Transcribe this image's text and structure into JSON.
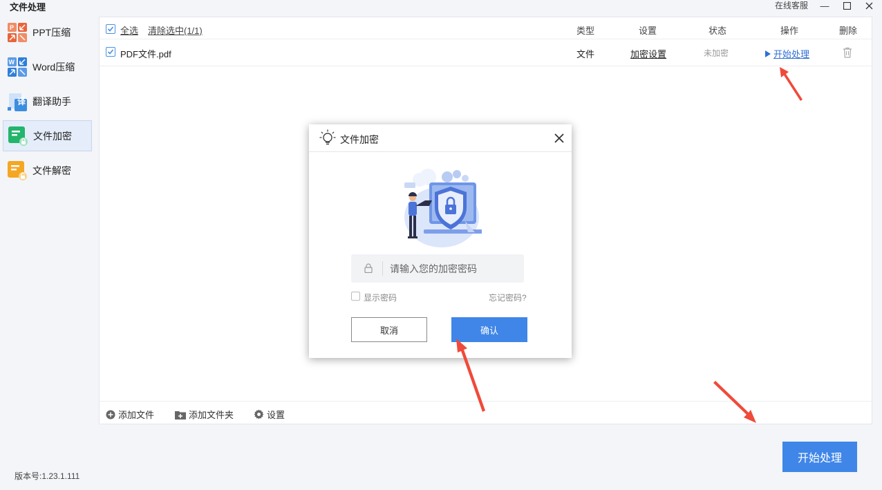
{
  "window": {
    "title": "文件处理",
    "online_service": "在线客服",
    "minimize_glyph": "—",
    "maximize_glyph": "☐",
    "close_glyph": "✕"
  },
  "sidebar": {
    "items": [
      {
        "label": "PPT压缩",
        "icon": "ppt-compress-icon",
        "color": "#e8643c"
      },
      {
        "label": "Word压缩",
        "icon": "word-compress-icon",
        "color": "#2f7fd8"
      },
      {
        "label": "翻译助手",
        "icon": "translate-icon",
        "color": "#3b8de0",
        "glyph": "译"
      },
      {
        "label": "文件加密",
        "icon": "file-encrypt-icon",
        "color": "#23b56b",
        "active": true
      },
      {
        "label": "文件解密",
        "icon": "file-decrypt-icon",
        "color": "#f5a623"
      }
    ]
  },
  "table": {
    "select_all": "全选",
    "clear_selected": "清除选中(1/1)",
    "columns": {
      "type": "类型",
      "settings": "设置",
      "status": "状态",
      "action": "操作",
      "delete": "删除"
    },
    "rows": [
      {
        "name": "PDF文件.pdf",
        "type": "文件",
        "settings": "加密设置",
        "status": "未加密",
        "action": "开始处理"
      }
    ]
  },
  "footer": {
    "add_file": "添加文件",
    "add_folder": "添加文件夹",
    "settings": "设置"
  },
  "start_button": "开始处理",
  "version": "版本号:1.23.1.111",
  "dialog": {
    "title": "文件加密",
    "password_placeholder": "请输入您的加密密码",
    "show_password": "显示密码",
    "forgot_password": "忘记密码?",
    "cancel": "取消",
    "confirm": "确认"
  },
  "colors": {
    "accent": "#3f86e8",
    "link": "#2f6fd4",
    "arrow": "#f04a3a",
    "status_gray": "#999999"
  }
}
